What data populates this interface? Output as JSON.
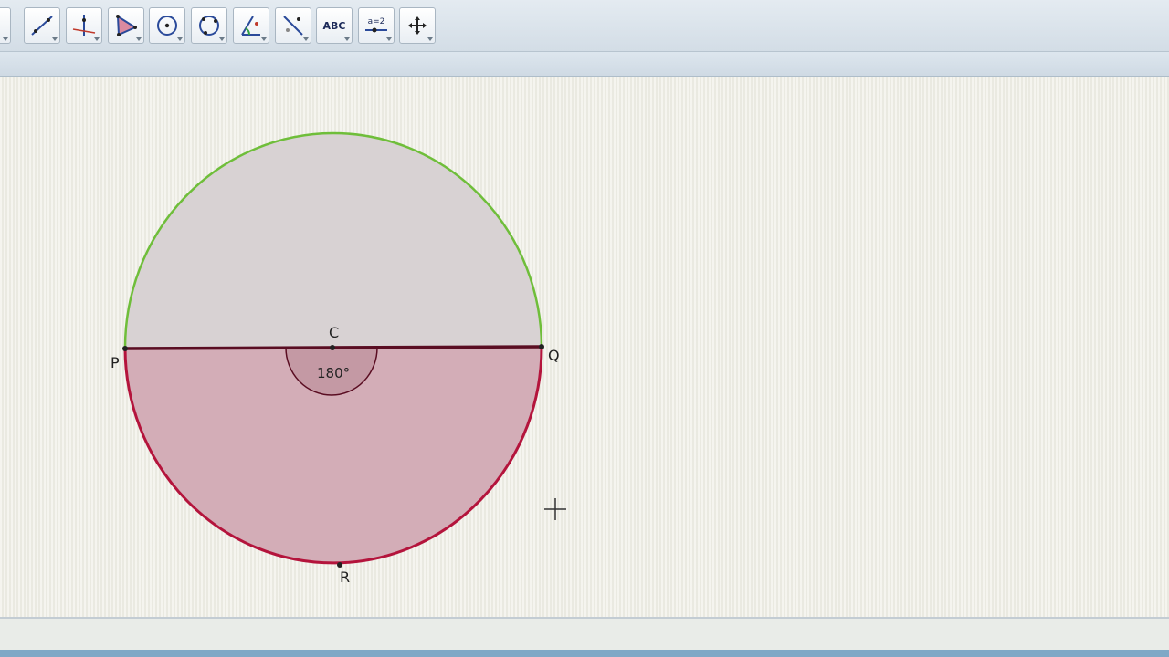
{
  "toolbar": {
    "tools": [
      {
        "id": "move",
        "icon": "move-arrow-icon"
      },
      {
        "id": "line",
        "icon": "line-through-points-icon"
      },
      {
        "id": "perpendicular",
        "icon": "perpendicular-line-icon"
      },
      {
        "id": "polygon",
        "icon": "polygon-icon"
      },
      {
        "id": "circle",
        "icon": "circle-center-point-icon"
      },
      {
        "id": "circle3",
        "icon": "circle-three-points-icon"
      },
      {
        "id": "angle",
        "icon": "angle-icon"
      },
      {
        "id": "reflect",
        "icon": "reflect-line-icon"
      },
      {
        "id": "text",
        "icon": "text-abc-icon",
        "label": "ABC"
      },
      {
        "id": "slider",
        "icon": "slider-icon",
        "label": "a=2"
      },
      {
        "id": "move-view",
        "icon": "move-graphics-view-icon"
      }
    ]
  },
  "geometry": {
    "points": {
      "P": "P",
      "Q": "Q",
      "C": "C",
      "R": "R"
    },
    "angle_label": "180°"
  },
  "colors": {
    "upper_arc": "#6fbe3a",
    "lower_arc": "#b4143c",
    "diameter": "#5a0d22",
    "upper_fill": "#d8d2d3",
    "lower_fill": "#d3adb7",
    "angle_fill": "#c499a4"
  }
}
